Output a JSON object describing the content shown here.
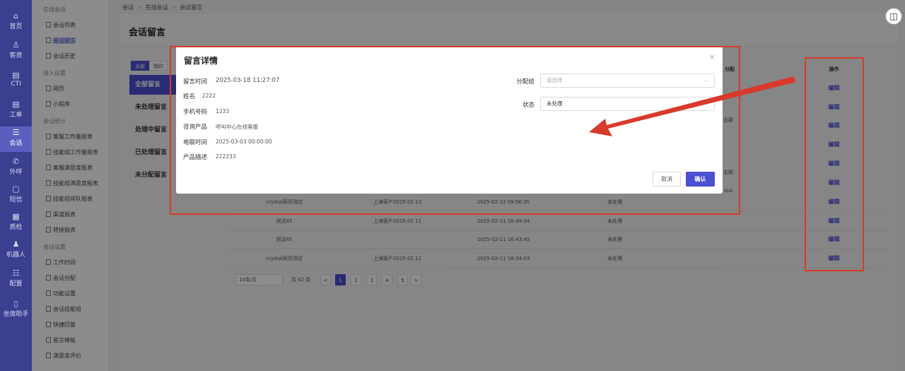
{
  "rail": [
    {
      "label": "首页",
      "icon": "home-icon",
      "glyph": "⌂"
    },
    {
      "label": "客资",
      "icon": "people-icon",
      "glyph": "♙"
    },
    {
      "label": "CTI",
      "icon": "cti-icon",
      "glyph": "▤"
    },
    {
      "label": "工单",
      "icon": "ticket-icon",
      "glyph": "▤"
    },
    {
      "label": "会话",
      "icon": "chat-icon",
      "glyph": "☰"
    },
    {
      "label": "外呼",
      "icon": "phone-icon",
      "glyph": "✆"
    },
    {
      "label": "短信",
      "icon": "sms-icon",
      "glyph": "▢"
    },
    {
      "label": "质检",
      "icon": "inspect-icon",
      "glyph": "▦"
    },
    {
      "label": "机器人",
      "icon": "robot-icon",
      "glyph": "♟"
    },
    {
      "label": "配置",
      "icon": "config-icon",
      "glyph": "☷"
    },
    {
      "label": "坐席助手",
      "icon": "assistant-icon",
      "glyph": "▯"
    }
  ],
  "submenu": {
    "groups": [
      {
        "title": "在线会话",
        "items": [
          "会话列表",
          "会话留言",
          "会话历史"
        ]
      },
      {
        "title": "接入设置",
        "items": [
          "网页",
          "小程序"
        ]
      },
      {
        "title": "会话统计",
        "items": [
          "客服工作量报表",
          "技能组工作量报表",
          "客服满意度报表",
          "技能组满意度报表",
          "技能组排队报表",
          "渠道报表",
          "转接报表"
        ]
      },
      {
        "title": "会话设置",
        "items": [
          "工作时间",
          "会话分配",
          "功能设置",
          "会话技能组",
          "快捷回复",
          "留言模板",
          "满意度评价"
        ]
      }
    ]
  },
  "breadcrumb": [
    "会话",
    "在线会话",
    "会话留言"
  ],
  "page_title": "会话留言",
  "category_tabs": [
    "全部",
    "我的"
  ],
  "left_filters": [
    "全部留言",
    "未处理留言",
    "处理中留言",
    "已处理留言",
    "未分配留言"
  ],
  "table": {
    "headers": {
      "assign": "分配",
      "action": "操作"
    },
    "partial_cells": [
      "志颖",
      "志颖",
      "stal"
    ],
    "rows": [
      {
        "name": "crystal网页测试",
        "customer": "上海客户2025.02.13",
        "time": "2025-02-13 09:56:35",
        "status": "未处理",
        "action": "编辑"
      },
      {
        "name": "测试45",
        "customer": "上海客户2025.02.11",
        "time": "2025-02-11 16:49:34",
        "status": "未处理",
        "action": "编辑"
      },
      {
        "name": "测试45",
        "customer": "",
        "time": "2025-02-11 16:43:45",
        "status": "未处理",
        "action": "编辑"
      },
      {
        "name": "crystal网页测试",
        "customer": "上海客户2025.02.11",
        "time": "2025-02-11 16:34:03",
        "status": "未处理",
        "action": "编辑"
      }
    ],
    "hidden_actions": [
      "编辑",
      "编辑",
      "编辑",
      "编辑",
      "编辑",
      "编辑"
    ]
  },
  "pager": {
    "page_size": "10条/页",
    "total": "共 42 条",
    "pages": [
      "1",
      "2",
      "3",
      "4",
      "5"
    ],
    "current": "1",
    "prev": "<",
    "next": ">"
  },
  "modal": {
    "title": "留言详情",
    "close": "×",
    "fields": [
      {
        "label": "留言时间",
        "value": "2025-03-18 11:27:07"
      },
      {
        "label": "姓名",
        "value": "2222"
      },
      {
        "label": "手机号码",
        "value": "1233"
      },
      {
        "label": "咨询产品",
        "value": "呼叫中心在线客服"
      },
      {
        "label": "电联时间",
        "value": "2025-03-03 00:00:00"
      },
      {
        "label": "产品描述",
        "value": "222233"
      }
    ],
    "assign_label": "分配给",
    "assign_placeholder": "请选择",
    "status_label": "状态",
    "status_value": "未处理",
    "cancel": "取消",
    "confirm": "确认"
  },
  "colors": {
    "primary": "#4b4fd1",
    "annotation": "#d83a2a",
    "rail": "#3b3f8f"
  }
}
